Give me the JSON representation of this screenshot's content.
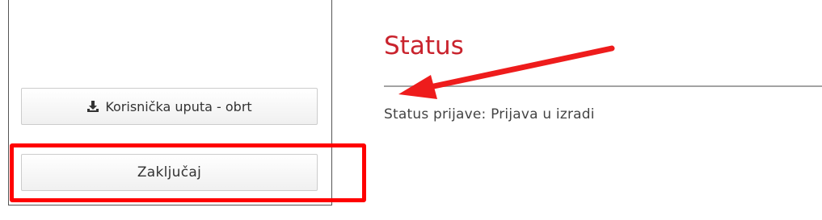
{
  "left_panel": {
    "manual_button": {
      "label": "Korisnička uputa - obrt",
      "icon": "download-icon"
    },
    "lock_button": {
      "label": "Zaključaj"
    }
  },
  "status_section": {
    "title": "Status",
    "status_label": "Status prijave: Prijava u izradi"
  },
  "annotations": {
    "highlight_color": "#ff0000",
    "arrow_color": "#ee1c1c"
  },
  "colors": {
    "title": "#c9232d",
    "rule": "#a3a3a3",
    "text": "#444444"
  }
}
